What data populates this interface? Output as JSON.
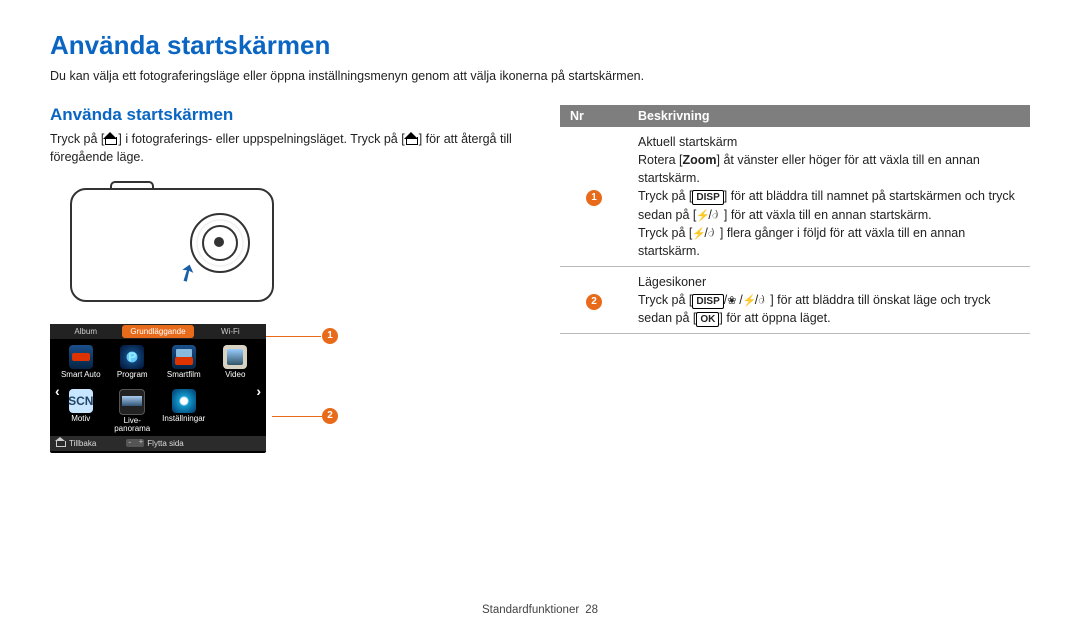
{
  "page_title": "Använda startskärmen",
  "intro": "Du kan välja ett fotograferingsläge eller öppna inställningsmenyn genom att välja ikonerna på startskärmen.",
  "section_title": "Använda startskärmen",
  "body_text_pre": "Tryck på [",
  "body_text_mid": "] i fotograferings- eller uppspelningsläget. Tryck på [",
  "body_text_post": "] för att återgå till föregående läge.",
  "tabs": {
    "album": "Album",
    "basic": "Grundläggande",
    "wifi": "Wi-Fi"
  },
  "modes": {
    "smart_auto": "Smart Auto",
    "program": "Program",
    "smartfilm": "Smartfilm",
    "video": "Video",
    "motiv": "Motiv",
    "pano": "Live-panorama",
    "settings": "Inställningar",
    "p_glyph": "P",
    "scn_glyph": "SCN"
  },
  "chevrons": {
    "left": "‹",
    "right": "›"
  },
  "bottom_bar": {
    "back": "Tillbaka",
    "move": "Flytta sida"
  },
  "callouts": {
    "one": "1",
    "two": "2"
  },
  "table": {
    "head_nr": "Nr",
    "head_desc": "Beskrivning",
    "row1": {
      "num": "1",
      "l1": "Aktuell startskärm",
      "l2a": "Rotera [",
      "l2_zoom": "Zoom",
      "l2b": "] åt vänster eller höger för att växla till en annan startskärm.",
      "l3a": "Tryck på [",
      "l3_disp": "DISP",
      "l3b": "] för att bläddra till namnet på startskärmen och tryck sedan på [",
      "l3c": "] för att växla till en annan startskärm.",
      "l4a": "Tryck på [",
      "l4b": "] flera gånger i följd för att växla till en annan startskärm."
    },
    "row2": {
      "num": "2",
      "l1": "Lägesikoner",
      "l2a": "Tryck på [",
      "l2_disp": "DISP",
      "l2b": "] för att bläddra till önskat läge och tryck sedan på [",
      "l2_ok": "OK",
      "l2c": "] för att öppna läget."
    }
  },
  "sep": "/",
  "footer": {
    "section": "Standardfunktioner",
    "page": "28"
  }
}
